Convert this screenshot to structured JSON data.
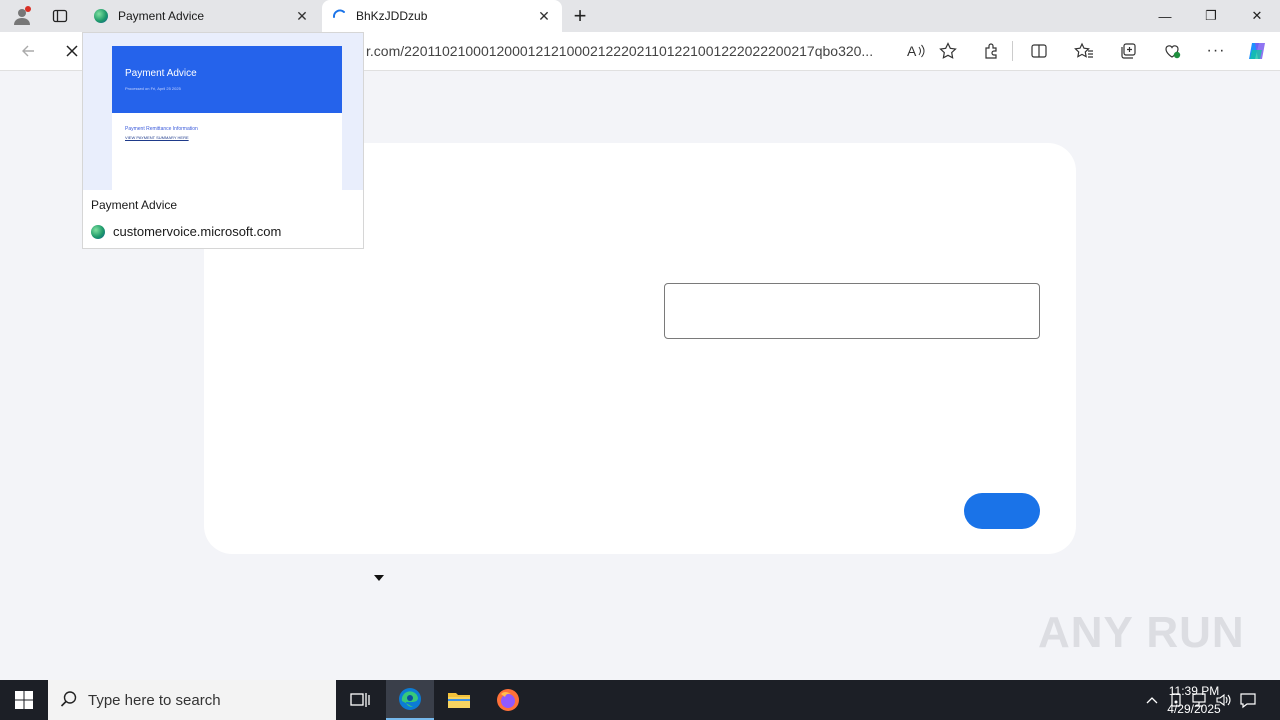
{
  "browser": {
    "tabs": [
      {
        "title": "Payment Advice",
        "icon": "edge-favicon-icon"
      },
      {
        "title": "BhKzJDDzub",
        "icon": "loading-spinner-icon"
      }
    ],
    "address_url": "r.com/22011021000120001212100021222021101221001222022200217qbo320..."
  },
  "hover_card": {
    "thumb_title": "Payment Advice",
    "thumb_subtitle": "Processed on Fri, April 25 2025",
    "thumb_section": "Payment Remittance Information",
    "thumb_link": "VIEW PAYMENT SUMMARY HERE",
    "title": "Payment Advice",
    "domain": "customervoice.microsoft.com"
  },
  "page": {
    "input_value": "",
    "next_button_label": ""
  },
  "watermark": "ANY RUN",
  "taskbar": {
    "search_placeholder": "Type here to search",
    "time": "11:39 PM",
    "date": "4/29/2025"
  },
  "colors": {
    "accent_button": "#1a73e8",
    "thumb_banner": "#2563eb",
    "taskbar_bg": "#1c1f26"
  }
}
